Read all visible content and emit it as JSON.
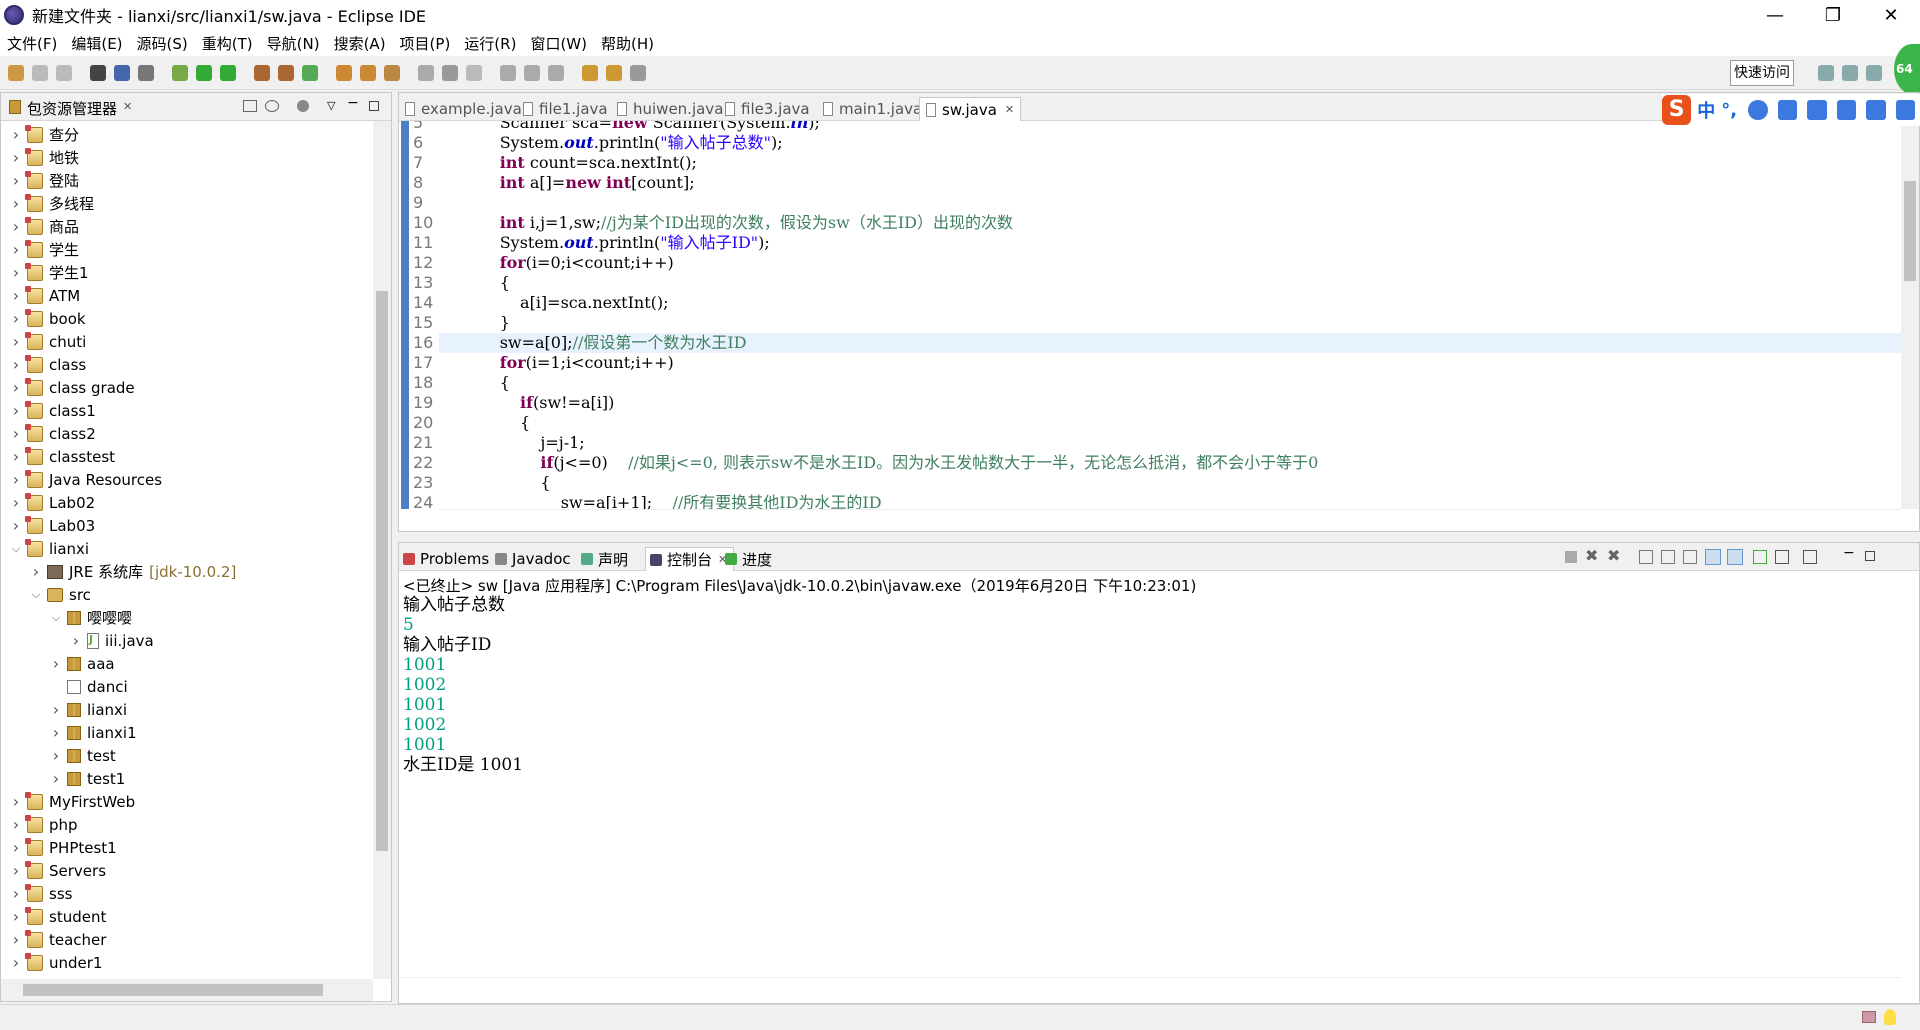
{
  "window": {
    "title": "新建文件夹 - lianxi/src/lianxi1/sw.java - Eclipse IDE",
    "controls": [
      "—",
      "❐",
      "✕"
    ]
  },
  "menubar": [
    "文件(F)",
    "编辑(E)",
    "源码(S)",
    "重构(T)",
    "导航(N)",
    "搜索(A)",
    "项目(P)",
    "运行(R)",
    "窗口(W)",
    "帮助(H)"
  ],
  "toolbar": {
    "quick_access": "快速访问"
  },
  "perf_badge": "64",
  "ime": {
    "logo": "S",
    "lang": "中",
    "punct": "°,"
  },
  "package_explorer": {
    "title": "包资源管理器",
    "items": [
      {
        "label": "查分",
        "icon": "project-icon"
      },
      {
        "label": "地铁",
        "icon": "project-icon"
      },
      {
        "label": "登陆",
        "icon": "project-icon"
      },
      {
        "label": "多线程",
        "icon": "project-icon"
      },
      {
        "label": "商品",
        "icon": "project-icon"
      },
      {
        "label": "学生",
        "icon": "project-icon"
      },
      {
        "label": "学生1",
        "icon": "project-icon"
      },
      {
        "label": "ATM",
        "icon": "project-icon"
      },
      {
        "label": "book",
        "icon": "project-icon"
      },
      {
        "label": "chuti",
        "icon": "project-icon"
      },
      {
        "label": "class",
        "icon": "project-icon"
      },
      {
        "label": "class grade",
        "icon": "project-icon"
      },
      {
        "label": "class1",
        "icon": "project-icon"
      },
      {
        "label": "class2",
        "icon": "project-icon"
      },
      {
        "label": "classtest",
        "icon": "project-icon"
      },
      {
        "label": "Java Resources",
        "icon": "project-icon"
      },
      {
        "label": "Lab02",
        "icon": "project-icon"
      },
      {
        "label": "Lab03",
        "icon": "project-icon"
      },
      {
        "label": "lianxi",
        "icon": "project-icon",
        "expanded": true
      },
      {
        "label": "JRE 系统库",
        "suffix": "[jdk-10.0.2]",
        "icon": "jre-icon",
        "level": 1
      },
      {
        "label": "src",
        "icon": "src-icon",
        "level": 1,
        "expanded": true
      },
      {
        "label": "嘤嘤嘤",
        "icon": "package-icon",
        "level": 2,
        "expanded": true
      },
      {
        "label": "iii.java",
        "icon": "java-file-icon",
        "level": 3
      },
      {
        "label": "aaa",
        "icon": "package-icon",
        "level": 2
      },
      {
        "label": "danci",
        "icon": "package-empty-icon",
        "level": 2,
        "nochev": true
      },
      {
        "label": "lianxi",
        "icon": "package-icon",
        "level": 2
      },
      {
        "label": "lianxi1",
        "icon": "package-icon",
        "level": 2
      },
      {
        "label": "test",
        "icon": "package-icon",
        "level": 2
      },
      {
        "label": "test1",
        "icon": "package-icon",
        "level": 2
      },
      {
        "label": "MyFirstWeb",
        "icon": "project-icon"
      },
      {
        "label": "php",
        "icon": "project-icon"
      },
      {
        "label": "PHPtest1",
        "icon": "project-icon"
      },
      {
        "label": "Servers",
        "icon": "project-icon"
      },
      {
        "label": "sss",
        "icon": "project-icon"
      },
      {
        "label": "student",
        "icon": "project-icon"
      },
      {
        "label": "teacher",
        "icon": "project-icon"
      },
      {
        "label": "under1",
        "icon": "project-icon"
      }
    ]
  },
  "editor": {
    "tabs": [
      {
        "label": "example.java",
        "active": false
      },
      {
        "label": "file1.java",
        "active": false
      },
      {
        "label": "huiwen.java",
        "active": false
      },
      {
        "label": "file3.java",
        "active": false
      },
      {
        "label": "main1.java",
        "active": false
      },
      {
        "label": "sw.java",
        "active": true
      }
    ],
    "lines": [
      {
        "n": "5",
        "indent": 8,
        "tokens": [
          [
            "Scanner sca=",
            ""
          ],
          [
            "new",
            "kw"
          ],
          [
            " Scanner(System.",
            ""
          ],
          [
            "in",
            "fld"
          ],
          [
            ");",
            ""
          ]
        ]
      },
      {
        "n": "6",
        "indent": 8,
        "tokens": [
          [
            "System.",
            ""
          ],
          [
            "out",
            "fld"
          ],
          [
            ".println(",
            ""
          ],
          [
            "\"输入帖子总数\"",
            "str"
          ],
          [
            ");",
            ""
          ]
        ]
      },
      {
        "n": "7",
        "indent": 8,
        "tokens": [
          [
            "int",
            "kw"
          ],
          [
            " count=sca.nextInt();",
            ""
          ]
        ]
      },
      {
        "n": "8",
        "indent": 8,
        "tokens": [
          [
            "int",
            "kw"
          ],
          [
            " a[]=",
            ""
          ],
          [
            "new",
            "kw"
          ],
          [
            " ",
            ""
          ],
          [
            "int",
            "kw"
          ],
          [
            "[count];",
            ""
          ]
        ]
      },
      {
        "n": "9",
        "indent": 0,
        "tokens": []
      },
      {
        "n": "10",
        "indent": 8,
        "tokens": [
          [
            "int",
            "kw"
          ],
          [
            " i,j=1,sw;",
            ""
          ],
          [
            "//j为某个ID出现的次数，假设为sw（水王ID）出现的次数",
            "cm"
          ]
        ]
      },
      {
        "n": "11",
        "indent": 8,
        "tokens": [
          [
            "System.",
            ""
          ],
          [
            "out",
            "fld"
          ],
          [
            ".println(",
            ""
          ],
          [
            "\"输入帖子ID\"",
            "str"
          ],
          [
            ");",
            ""
          ]
        ]
      },
      {
        "n": "12",
        "indent": 8,
        "tokens": [
          [
            "for",
            "kw"
          ],
          [
            "(i=0;i<count;i++)",
            ""
          ]
        ]
      },
      {
        "n": "13",
        "indent": 8,
        "tokens": [
          [
            "{",
            ""
          ]
        ]
      },
      {
        "n": "14",
        "indent": 12,
        "tokens": [
          [
            "a[i]=sca.nextInt();",
            ""
          ]
        ]
      },
      {
        "n": "15",
        "indent": 8,
        "tokens": [
          [
            "}",
            ""
          ]
        ]
      },
      {
        "n": "16",
        "indent": 8,
        "tokens": [
          [
            "sw=a[0];",
            ""
          ],
          [
            "//假设第一个数为水王ID",
            "cm"
          ]
        ],
        "highlight": true
      },
      {
        "n": "17",
        "indent": 8,
        "tokens": [
          [
            "for",
            "kw"
          ],
          [
            "(i=1;i<count;i++)",
            ""
          ]
        ]
      },
      {
        "n": "18",
        "indent": 8,
        "tokens": [
          [
            "{",
            ""
          ]
        ]
      },
      {
        "n": "19",
        "indent": 12,
        "tokens": [
          [
            "if",
            "kw"
          ],
          [
            "(sw!=a[i])",
            ""
          ]
        ]
      },
      {
        "n": "20",
        "indent": 12,
        "tokens": [
          [
            "{",
            ""
          ]
        ]
      },
      {
        "n": "21",
        "indent": 16,
        "tokens": [
          [
            "j=j-1;",
            ""
          ]
        ]
      },
      {
        "n": "22",
        "indent": 16,
        "tokens": [
          [
            "if",
            "kw"
          ],
          [
            "(j<=0)    ",
            ""
          ],
          [
            "//如果j<=0, 则表示sw不是水王ID。因为水王发帖数大于一半，无论怎么抵消，都不会小于等于0",
            "cm"
          ]
        ]
      },
      {
        "n": "23",
        "indent": 16,
        "tokens": [
          [
            "{",
            ""
          ]
        ]
      },
      {
        "n": "24",
        "indent": 20,
        "tokens": [
          [
            "sw=a[i+1];    ",
            ""
          ],
          [
            "//所有要换其他ID为水王的ID",
            "cm"
          ]
        ]
      }
    ]
  },
  "console": {
    "tabs": [
      {
        "label": "Problems",
        "active": false,
        "color": "#c44"
      },
      {
        "label": "Javadoc",
        "active": false,
        "color": "#888"
      },
      {
        "label": "声明",
        "active": false,
        "color": "#5a8"
      },
      {
        "label": "控制台",
        "active": true,
        "color": "#446"
      },
      {
        "label": "进度",
        "active": false,
        "color": "#4a4"
      }
    ],
    "status": "<已终止> sw [Java 应用程序] C:\\Program Files\\Java\\jdk-10.0.2\\bin\\javaw.exe（2019年6月20日 下午10:23:01)",
    "output": [
      {
        "text": "输入帖子总数",
        "input": false
      },
      {
        "text": "5",
        "input": true
      },
      {
        "text": "输入帖子ID",
        "input": false
      },
      {
        "text": "1001",
        "input": true
      },
      {
        "text": "1002",
        "input": true
      },
      {
        "text": "1001",
        "input": true
      },
      {
        "text": "1002",
        "input": true
      },
      {
        "text": "1001",
        "input": true
      },
      {
        "text": "水王ID是 1001",
        "input": false
      }
    ]
  }
}
